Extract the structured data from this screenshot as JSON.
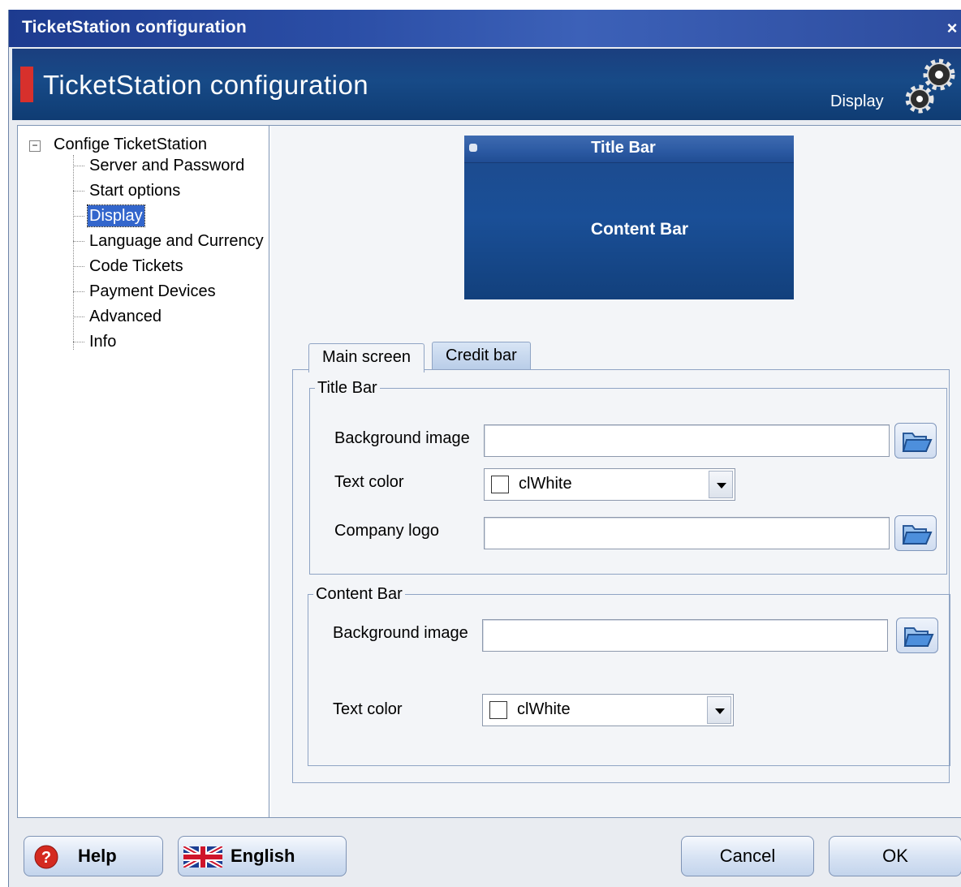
{
  "window": {
    "title": "TicketStation configuration",
    "close_glyph": "×"
  },
  "header": {
    "title": "TicketStation configuration",
    "section": "Display",
    "icon": "gears-icon"
  },
  "tree": {
    "root": "Confige TicketStation",
    "items": [
      {
        "label": "Server and Password",
        "selected": false
      },
      {
        "label": "Start options",
        "selected": false
      },
      {
        "label": "Display",
        "selected": true
      },
      {
        "label": "Language and Currency",
        "selected": false
      },
      {
        "label": "Code Tickets",
        "selected": false
      },
      {
        "label": "Payment Devices",
        "selected": false
      },
      {
        "label": "Advanced",
        "selected": false
      },
      {
        "label": "Info",
        "selected": false
      }
    ]
  },
  "preview": {
    "title_bar": "Title Bar",
    "content_bar": "Content Bar"
  },
  "tabs": [
    {
      "label": "Main screen",
      "active": true
    },
    {
      "label": "Credit bar",
      "active": false
    }
  ],
  "title_bar_group": {
    "legend": "Title Bar",
    "background_image_label": "Background image",
    "background_image_value": "",
    "text_color_label": "Text color",
    "text_color_value": "clWhite",
    "company_logo_label": "Company logo",
    "company_logo_value": ""
  },
  "content_bar_group": {
    "legend": "Content Bar",
    "background_image_label": "Background image",
    "background_image_value": "",
    "text_color_label": "Text color",
    "text_color_value": "clWhite"
  },
  "footer": {
    "help": "Help",
    "language": "English",
    "cancel": "Cancel",
    "ok": "OK"
  },
  "colors": {
    "accent": "#1b3f7f",
    "marker": "#d7302c",
    "selection": "#3366cc"
  }
}
